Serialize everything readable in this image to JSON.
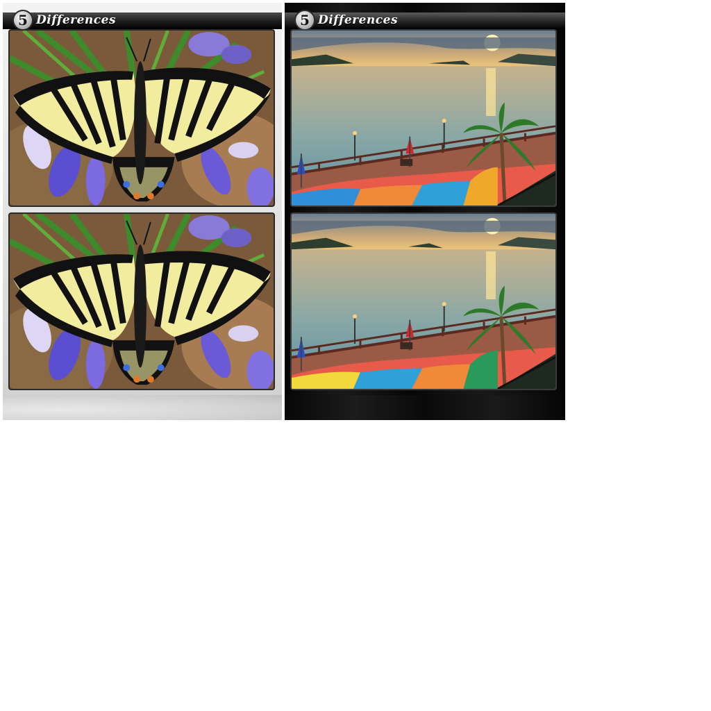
{
  "puzzles": [
    {
      "theme": "light",
      "difference_count": "5",
      "title": "Differences",
      "image_top": "butterfly on flowers",
      "image_bottom": "butterfly on flowers"
    },
    {
      "theme": "dark",
      "difference_count": "5",
      "title": "Differences",
      "image_top": "sunset seaside boardwalk",
      "image_bottom": "sunset seaside boardwalk"
    }
  ]
}
